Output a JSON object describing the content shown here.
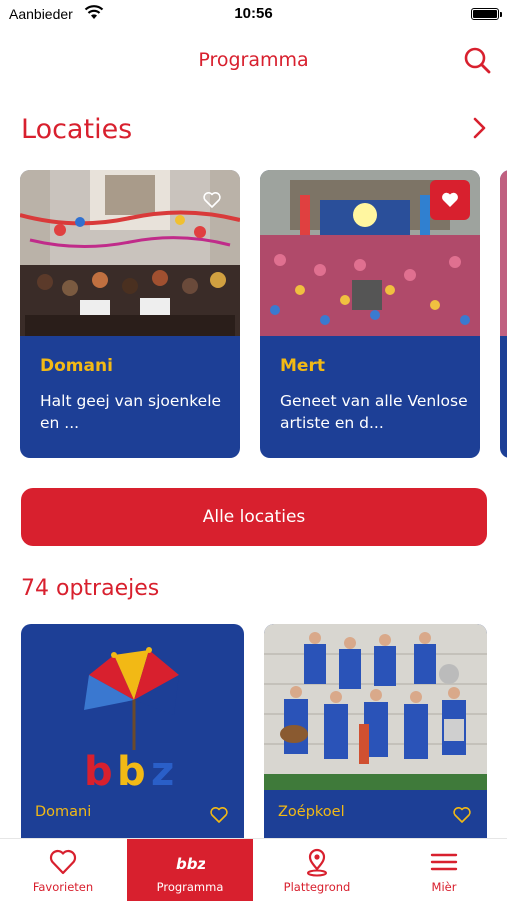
{
  "status_bar": {
    "carrier": "Aanbieder",
    "time": "10:56"
  },
  "header": {
    "title": "Programma"
  },
  "locations": {
    "heading": "Locaties",
    "cards": [
      {
        "title": "Domani",
        "description": "Halt geej van sjoenkele en ...",
        "favorited": false
      },
      {
        "title": "Mert",
        "description": "Geneet van alle Venlose artiste en d...",
        "favorited": true
      }
    ],
    "all_button": "Alle locaties"
  },
  "performances": {
    "heading": "74 optraejes",
    "tiles": [
      {
        "label": "Domani"
      },
      {
        "label": "Zoépkoel"
      }
    ]
  },
  "tabbar": {
    "items": [
      {
        "label": "Favorieten",
        "icon": "heart-icon"
      },
      {
        "label": "Programma",
        "icon": "bbz-logo-icon"
      },
      {
        "label": "Plattegrond",
        "icon": "map-pin-icon"
      },
      {
        "label": "Mièr",
        "icon": "menu-icon"
      }
    ],
    "active_index": 1
  },
  "colors": {
    "brand_red": "#d8202e",
    "brand_blue": "#1d3f96",
    "accent_yellow": "#f2b915"
  }
}
